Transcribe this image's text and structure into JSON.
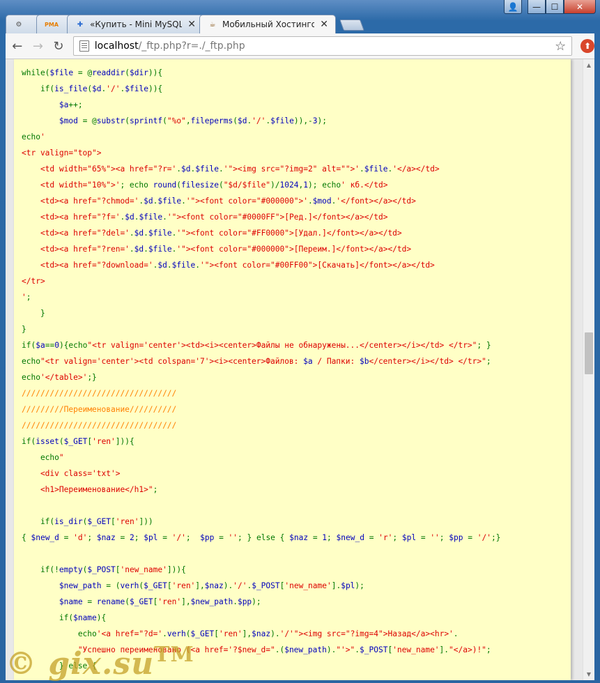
{
  "window": {
    "controls": {
      "user": "👤",
      "minimize": "—",
      "maximize": "☐",
      "close": "✕"
    }
  },
  "tabs": [
    {
      "title": "",
      "icon": "gear-icon",
      "glyph": "⚙",
      "active": false
    },
    {
      "title": "",
      "icon": "pma-icon",
      "glyph": "PMA",
      "active": false
    },
    {
      "title": "«Купить - Mini MySQL-м",
      "icon": "site-icon",
      "glyph": "✚",
      "active": false
    },
    {
      "title": "Мобильный Хостингов",
      "icon": "coffee-icon",
      "glyph": "☕",
      "active": true
    }
  ],
  "toolbar": {
    "back": "←",
    "forward": "→",
    "reload": "↻",
    "url_host": "localhost",
    "url_path": "/_ftp.php?r=./_ftp.php",
    "star": "☆",
    "ext": "⬆"
  },
  "code_lines": [
    [
      {
        "c": "k",
        "t": "while("
      },
      {
        "c": "v",
        "t": "$file "
      },
      {
        "c": "k",
        "t": "= @"
      },
      {
        "c": "v",
        "t": "readdir"
      },
      {
        "c": "k",
        "t": "("
      },
      {
        "c": "v",
        "t": "$dir"
      },
      {
        "c": "k",
        "t": ")){"
      }
    ],
    [
      {
        "c": "k",
        "t": "    if("
      },
      {
        "c": "v",
        "t": "is_file"
      },
      {
        "c": "k",
        "t": "("
      },
      {
        "c": "v",
        "t": "$d"
      },
      {
        "c": "k",
        "t": "."
      },
      {
        "c": "s",
        "t": "'/'"
      },
      {
        "c": "k",
        "t": "."
      },
      {
        "c": "v",
        "t": "$file"
      },
      {
        "c": "k",
        "t": ")){"
      }
    ],
    [
      {
        "c": "k",
        "t": "        "
      },
      {
        "c": "v",
        "t": "$a"
      },
      {
        "c": "k",
        "t": "++;"
      }
    ],
    [
      {
        "c": "k",
        "t": "        "
      },
      {
        "c": "v",
        "t": "$mod "
      },
      {
        "c": "k",
        "t": "= @"
      },
      {
        "c": "v",
        "t": "substr"
      },
      {
        "c": "k",
        "t": "("
      },
      {
        "c": "v",
        "t": "sprintf"
      },
      {
        "c": "k",
        "t": "("
      },
      {
        "c": "s",
        "t": "\"%o\""
      },
      {
        "c": "k",
        "t": ","
      },
      {
        "c": "v",
        "t": "fileperms"
      },
      {
        "c": "k",
        "t": "("
      },
      {
        "c": "v",
        "t": "$d"
      },
      {
        "c": "k",
        "t": "."
      },
      {
        "c": "s",
        "t": "'/'"
      },
      {
        "c": "k",
        "t": "."
      },
      {
        "c": "v",
        "t": "$file"
      },
      {
        "c": "k",
        "t": ")),-"
      },
      {
        "c": "v",
        "t": "3"
      },
      {
        "c": "k",
        "t": ");"
      }
    ],
    [
      {
        "c": "k",
        "t": "echo"
      },
      {
        "c": "s",
        "t": "'"
      }
    ],
    [
      {
        "c": "s",
        "t": "<tr valign=\"top\">"
      }
    ],
    [
      {
        "c": "s",
        "t": "    <td width=\"65%\"><a href=\"?r='"
      },
      {
        "c": "k",
        "t": "."
      },
      {
        "c": "v",
        "t": "$d"
      },
      {
        "c": "k",
        "t": "."
      },
      {
        "c": "v",
        "t": "$file"
      },
      {
        "c": "k",
        "t": "."
      },
      {
        "c": "s",
        "t": "'\"><img src=\"?img=2\" alt=\"\">'"
      },
      {
        "c": "k",
        "t": "."
      },
      {
        "c": "v",
        "t": "$file"
      },
      {
        "c": "k",
        "t": "."
      },
      {
        "c": "s",
        "t": "'</a></td>"
      }
    ],
    [
      {
        "c": "s",
        "t": "    <td width=\"10%\">'"
      },
      {
        "c": "k",
        "t": "; echo "
      },
      {
        "c": "v",
        "t": "round"
      },
      {
        "c": "k",
        "t": "("
      },
      {
        "c": "v",
        "t": "filesize"
      },
      {
        "c": "k",
        "t": "("
      },
      {
        "c": "s",
        "t": "\"$d/$file\""
      },
      {
        "c": "k",
        "t": ")/"
      },
      {
        "c": "v",
        "t": "1024"
      },
      {
        "c": "k",
        "t": ","
      },
      {
        "c": "v",
        "t": "1"
      },
      {
        "c": "k",
        "t": "); echo"
      },
      {
        "c": "s",
        "t": "' кб.</td>"
      }
    ],
    [
      {
        "c": "s",
        "t": "    <td><a href=\"?chmod='"
      },
      {
        "c": "k",
        "t": "."
      },
      {
        "c": "v",
        "t": "$d"
      },
      {
        "c": "k",
        "t": "."
      },
      {
        "c": "v",
        "t": "$file"
      },
      {
        "c": "k",
        "t": "."
      },
      {
        "c": "s",
        "t": "'\"><font color=\"#000000\">'"
      },
      {
        "c": "k",
        "t": "."
      },
      {
        "c": "v",
        "t": "$mod"
      },
      {
        "c": "k",
        "t": "."
      },
      {
        "c": "s",
        "t": "'</font></a></td>"
      }
    ],
    [
      {
        "c": "s",
        "t": "    <td><a href=\"?f='"
      },
      {
        "c": "k",
        "t": "."
      },
      {
        "c": "v",
        "t": "$d"
      },
      {
        "c": "k",
        "t": "."
      },
      {
        "c": "v",
        "t": "$file"
      },
      {
        "c": "k",
        "t": "."
      },
      {
        "c": "s",
        "t": "'\"><font color=\"#0000FF\">[Ред.]</font></a></td>"
      }
    ],
    [
      {
        "c": "s",
        "t": "    <td><a href=\"?del='"
      },
      {
        "c": "k",
        "t": "."
      },
      {
        "c": "v",
        "t": "$d"
      },
      {
        "c": "k",
        "t": "."
      },
      {
        "c": "v",
        "t": "$file"
      },
      {
        "c": "k",
        "t": "."
      },
      {
        "c": "s",
        "t": "'\"><font color=\"#FF0000\">[Удал.]</font></a></td>"
      }
    ],
    [
      {
        "c": "s",
        "t": "    <td><a href=\"?ren='"
      },
      {
        "c": "k",
        "t": "."
      },
      {
        "c": "v",
        "t": "$d"
      },
      {
        "c": "k",
        "t": "."
      },
      {
        "c": "v",
        "t": "$file"
      },
      {
        "c": "k",
        "t": "."
      },
      {
        "c": "s",
        "t": "'\"><font color=\"#000000\">[Переим.]</font></a></td>"
      }
    ],
    [
      {
        "c": "s",
        "t": "    <td><a href=\"?download='"
      },
      {
        "c": "k",
        "t": "."
      },
      {
        "c": "v",
        "t": "$d"
      },
      {
        "c": "k",
        "t": "."
      },
      {
        "c": "v",
        "t": "$file"
      },
      {
        "c": "k",
        "t": "."
      },
      {
        "c": "s",
        "t": "'\"><font color=\"#00FF00\">[Скачать]</font></a></td>"
      }
    ],
    [
      {
        "c": "s",
        "t": "</tr>"
      }
    ],
    [
      {
        "c": "s",
        "t": "'"
      },
      {
        "c": "k",
        "t": ";"
      }
    ],
    [
      {
        "c": "k",
        "t": "    }"
      }
    ],
    [
      {
        "c": "k",
        "t": "}"
      }
    ],
    [
      {
        "c": "k",
        "t": "if("
      },
      {
        "c": "v",
        "t": "$a"
      },
      {
        "c": "k",
        "t": "=="
      },
      {
        "c": "v",
        "t": "0"
      },
      {
        "c": "k",
        "t": "){echo"
      },
      {
        "c": "s",
        "t": "\"<tr valign='center'><td><i><center>Файлы не обнаружены...</center></i></td> </tr>\""
      },
      {
        "c": "k",
        "t": "; }"
      }
    ],
    [
      {
        "c": "k",
        "t": "echo"
      },
      {
        "c": "s",
        "t": "\"<tr valign='center'><td colspan='7'><i><center>Файлов: "
      },
      {
        "c": "v",
        "t": "$a"
      },
      {
        "c": "s",
        "t": " / Папки: "
      },
      {
        "c": "v",
        "t": "$b"
      },
      {
        "c": "s",
        "t": "</center></i></td> </tr>\""
      },
      {
        "c": "k",
        "t": ";"
      }
    ],
    [
      {
        "c": "k",
        "t": "echo"
      },
      {
        "c": "s",
        "t": "'</table>'"
      },
      {
        "c": "k",
        "t": ";}"
      }
    ],
    [
      {
        "c": "c",
        "t": "/////////////////////////////////"
      }
    ],
    [
      {
        "c": "c",
        "t": "/////////Переименование//////////"
      }
    ],
    [
      {
        "c": "c",
        "t": "/////////////////////////////////"
      }
    ],
    [
      {
        "c": "k",
        "t": "if("
      },
      {
        "c": "v",
        "t": "isset"
      },
      {
        "c": "k",
        "t": "("
      },
      {
        "c": "v",
        "t": "$_GET"
      },
      {
        "c": "k",
        "t": "["
      },
      {
        "c": "s",
        "t": "'ren'"
      },
      {
        "c": "k",
        "t": "])){"
      }
    ],
    [
      {
        "c": "k",
        "t": "    echo"
      },
      {
        "c": "s",
        "t": "\""
      }
    ],
    [
      {
        "c": "s",
        "t": "    <div class='txt'>"
      }
    ],
    [
      {
        "c": "s",
        "t": "    <h1>Переименование</h1>\""
      },
      {
        "c": "k",
        "t": ";"
      }
    ],
    [
      {
        "c": "k",
        "t": ""
      }
    ],
    [
      {
        "c": "k",
        "t": "    if("
      },
      {
        "c": "v",
        "t": "is_dir"
      },
      {
        "c": "k",
        "t": "("
      },
      {
        "c": "v",
        "t": "$_GET"
      },
      {
        "c": "k",
        "t": "["
      },
      {
        "c": "s",
        "t": "'ren'"
      },
      {
        "c": "k",
        "t": "]))"
      }
    ],
    [
      {
        "c": "k",
        "t": "{ "
      },
      {
        "c": "v",
        "t": "$new_d "
      },
      {
        "c": "k",
        "t": "= "
      },
      {
        "c": "s",
        "t": "'d'"
      },
      {
        "c": "k",
        "t": "; "
      },
      {
        "c": "v",
        "t": "$naz "
      },
      {
        "c": "k",
        "t": "= "
      },
      {
        "c": "v",
        "t": "2"
      },
      {
        "c": "k",
        "t": "; "
      },
      {
        "c": "v",
        "t": "$pl "
      },
      {
        "c": "k",
        "t": "= "
      },
      {
        "c": "s",
        "t": "'/'"
      },
      {
        "c": "k",
        "t": ";  "
      },
      {
        "c": "v",
        "t": "$pp "
      },
      {
        "c": "k",
        "t": "= "
      },
      {
        "c": "s",
        "t": "''"
      },
      {
        "c": "k",
        "t": "; } else { "
      },
      {
        "c": "v",
        "t": "$naz "
      },
      {
        "c": "k",
        "t": "= "
      },
      {
        "c": "v",
        "t": "1"
      },
      {
        "c": "k",
        "t": "; "
      },
      {
        "c": "v",
        "t": "$new_d "
      },
      {
        "c": "k",
        "t": "= "
      },
      {
        "c": "s",
        "t": "'r'"
      },
      {
        "c": "k",
        "t": "; "
      },
      {
        "c": "v",
        "t": "$pl "
      },
      {
        "c": "k",
        "t": "= "
      },
      {
        "c": "s",
        "t": "''"
      },
      {
        "c": "k",
        "t": "; "
      },
      {
        "c": "v",
        "t": "$pp "
      },
      {
        "c": "k",
        "t": "= "
      },
      {
        "c": "s",
        "t": "'/'"
      },
      {
        "c": "k",
        "t": ";}"
      }
    ],
    [
      {
        "c": "k",
        "t": ""
      }
    ],
    [
      {
        "c": "k",
        "t": "    if(!"
      },
      {
        "c": "v",
        "t": "empty"
      },
      {
        "c": "k",
        "t": "("
      },
      {
        "c": "v",
        "t": "$_POST"
      },
      {
        "c": "k",
        "t": "["
      },
      {
        "c": "s",
        "t": "'new_name'"
      },
      {
        "c": "k",
        "t": "])){"
      }
    ],
    [
      {
        "c": "k",
        "t": "        "
      },
      {
        "c": "v",
        "t": "$new_path "
      },
      {
        "c": "k",
        "t": "= ("
      },
      {
        "c": "v",
        "t": "verh"
      },
      {
        "c": "k",
        "t": "("
      },
      {
        "c": "v",
        "t": "$_GET"
      },
      {
        "c": "k",
        "t": "["
      },
      {
        "c": "s",
        "t": "'ren'"
      },
      {
        "c": "k",
        "t": "],"
      },
      {
        "c": "v",
        "t": "$naz"
      },
      {
        "c": "k",
        "t": ")."
      },
      {
        "c": "s",
        "t": "'/'"
      },
      {
        "c": "k",
        "t": "."
      },
      {
        "c": "v",
        "t": "$_POST"
      },
      {
        "c": "k",
        "t": "["
      },
      {
        "c": "s",
        "t": "'new_name'"
      },
      {
        "c": "k",
        "t": "]."
      },
      {
        "c": "v",
        "t": "$pl"
      },
      {
        "c": "k",
        "t": ");"
      }
    ],
    [
      {
        "c": "k",
        "t": "        "
      },
      {
        "c": "v",
        "t": "$name "
      },
      {
        "c": "k",
        "t": "= "
      },
      {
        "c": "v",
        "t": "rename"
      },
      {
        "c": "k",
        "t": "("
      },
      {
        "c": "v",
        "t": "$_GET"
      },
      {
        "c": "k",
        "t": "["
      },
      {
        "c": "s",
        "t": "'ren'"
      },
      {
        "c": "k",
        "t": "],"
      },
      {
        "c": "v",
        "t": "$new_path"
      },
      {
        "c": "k",
        "t": "."
      },
      {
        "c": "v",
        "t": "$pp"
      },
      {
        "c": "k",
        "t": ");"
      }
    ],
    [
      {
        "c": "k",
        "t": "        if("
      },
      {
        "c": "v",
        "t": "$name"
      },
      {
        "c": "k",
        "t": "){"
      }
    ],
    [
      {
        "c": "k",
        "t": "            echo"
      },
      {
        "c": "s",
        "t": "'<a href=\"?d='"
      },
      {
        "c": "k",
        "t": "."
      },
      {
        "c": "v",
        "t": "verh"
      },
      {
        "c": "k",
        "t": "("
      },
      {
        "c": "v",
        "t": "$_GET"
      },
      {
        "c": "k",
        "t": "["
      },
      {
        "c": "s",
        "t": "'ren'"
      },
      {
        "c": "k",
        "t": "],"
      },
      {
        "c": "v",
        "t": "$naz"
      },
      {
        "c": "k",
        "t": ")."
      },
      {
        "c": "s",
        "t": "'/'\"><img src=\"?img=4\">Назад</a><hr>'"
      },
      {
        "c": "k",
        "t": "."
      }
    ],
    [
      {
        "c": "s",
        "t": "            \"Успешно переименовано (<a href='?$new_d=\""
      },
      {
        "c": "k",
        "t": ".("
      },
      {
        "c": "v",
        "t": "$new_path"
      },
      {
        "c": "k",
        "t": ")."
      },
      {
        "c": "s",
        "t": "\"'>\""
      },
      {
        "c": "k",
        "t": "."
      },
      {
        "c": "v",
        "t": "$_POST"
      },
      {
        "c": "k",
        "t": "["
      },
      {
        "c": "s",
        "t": "'new_name'"
      },
      {
        "c": "k",
        "t": "]."
      },
      {
        "c": "s",
        "t": "\"</a>)!\""
      },
      {
        "c": "k",
        "t": ";"
      }
    ],
    [
      {
        "c": "k",
        "t": "        } else {"
      }
    ]
  ],
  "watermark": {
    "text": "© gix.su",
    "tm": "TM"
  },
  "scrollbar": {
    "up": "▲",
    "down": "▼"
  }
}
